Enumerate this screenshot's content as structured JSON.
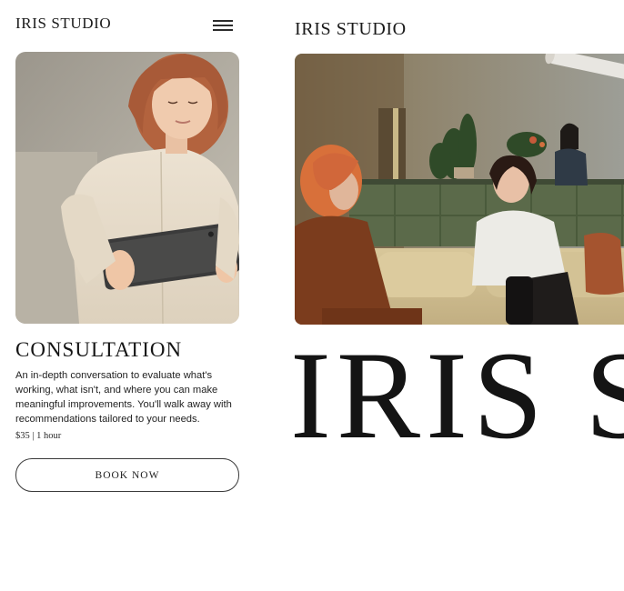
{
  "left": {
    "brand": "IRIS STUDIO",
    "menu_icon": "hamburger-menu-icon",
    "image_alt": "Woman holding a tablet",
    "service": {
      "title": "CONSULTATION",
      "description": "An in-depth conversation to evaluate what's working, what isn't, and where you can make meaningful improvements. You'll walk away with recommendations tailored to your needs.",
      "meta": "$35 | 1 hour",
      "book_label": "BOOK NOW"
    }
  },
  "right": {
    "brand": "IRIS STUDIO",
    "image_alt": "Two women talking in a studio lounge",
    "big_brand": "IRIS STUDIO"
  },
  "colors": {
    "text": "#1b1b1b",
    "background": "#ffffff",
    "button_border": "#3a3a3a"
  }
}
